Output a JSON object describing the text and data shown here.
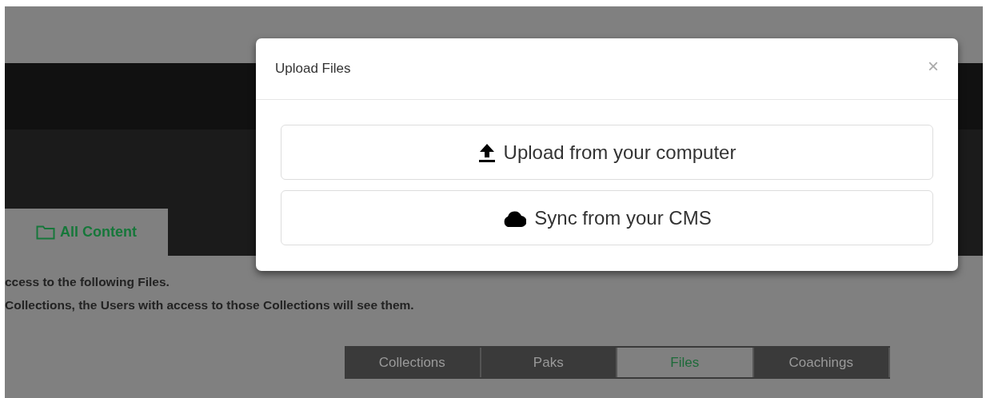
{
  "page": {
    "tabs": [
      {
        "label": "All Content",
        "selected": true
      }
    ],
    "notes": [
      "ccess to the following Files.",
      "Collections, the Users with access to those Collections will see them."
    ],
    "section_tabs": [
      {
        "label": "Collections",
        "selected": false
      },
      {
        "label": "Paks",
        "selected": false
      },
      {
        "label": "Files",
        "selected": true
      },
      {
        "label": "Coachings",
        "selected": false
      }
    ]
  },
  "modal": {
    "title": "Upload Files",
    "close": "×",
    "options": [
      {
        "kind": "upload",
        "label": "Upload from your computer"
      },
      {
        "kind": "cloud",
        "label": "Sync from your CMS"
      }
    ]
  }
}
